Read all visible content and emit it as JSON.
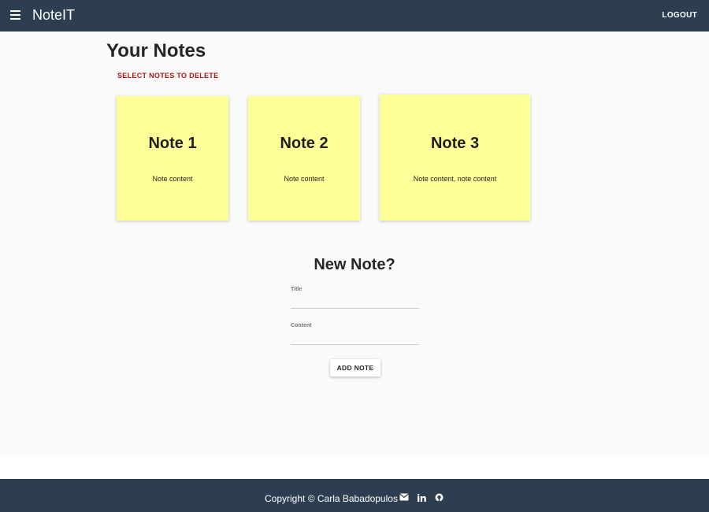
{
  "app": {
    "title": "NoteIT",
    "logout_label": "LOGOUT"
  },
  "page": {
    "heading": "Your Notes",
    "delete_label": "SELECT NOTES TO DELETE"
  },
  "notes": [
    {
      "title": "Note 1",
      "content": "Note content"
    },
    {
      "title": "Note 2",
      "content": "Note content"
    },
    {
      "title": "Note 3",
      "content": "Note content, note content"
    }
  ],
  "new_note": {
    "heading": "New Note?",
    "title_label": "Title",
    "content_label": "Content",
    "title_value": "",
    "content_value": "",
    "add_label": "ADD NOTE"
  },
  "footer": {
    "copyright": "Copyright © Carla Babadopulos",
    "icons": [
      "envelope-icon",
      "linkedin-icon",
      "github-icon"
    ]
  },
  "colors": {
    "appbar": "#2d3e50",
    "note_bg": "#ffff99",
    "delete_text": "#b01616",
    "page_bg": "#fafafa"
  }
}
